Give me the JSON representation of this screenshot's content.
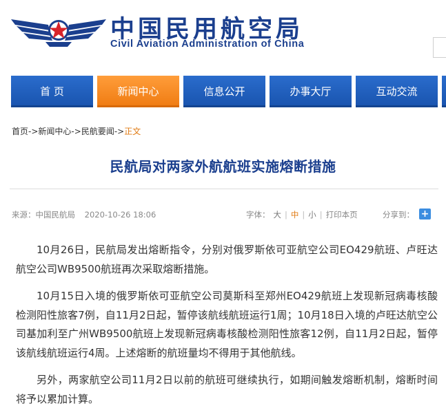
{
  "header": {
    "title_cn": "中国民用航空局",
    "title_en": "Civil Aviation Administration of China"
  },
  "nav": {
    "items": [
      {
        "label": "首  页"
      },
      {
        "label": "新闻中心"
      },
      {
        "label": "信息公开"
      },
      {
        "label": "办事大厅"
      },
      {
        "label": "互动交流"
      }
    ]
  },
  "breadcrumb": {
    "items": [
      "首页",
      "新闻中心",
      "民航要闻"
    ],
    "separator": "->",
    "current": "正文"
  },
  "article": {
    "title": "民航局对两家外航航班实施熔断措施",
    "source": "来源：中国民航局",
    "date": "2020-10-26 18:06",
    "font_label": "字体：",
    "font_options": [
      "大",
      "中",
      "小"
    ],
    "font_active": "中",
    "print_label": "打印本页",
    "share_label": "分享到：",
    "share_icon": "plus-icon",
    "paragraphs": [
      "10月26日，民航局发出熔断指令，分别对俄罗斯依可亚航空公司EO429航班、卢旺达航空公司WB9500航班再次采取熔断措施。",
      "10月15日入境的俄罗斯依可亚航空公司莫斯科至郑州EO429航班上发现新冠病毒核酸检测阳性旅客7例，自11月2日起，暂停该航线航班运行1周；10月18日入境的卢旺达航空公司基加利至广州WB9500航班上发现新冠病毒核酸检测阳性旅客12例，自11月2日起，暂停该航线航班运行4周。上述熔断的航班量均不得用于其他航线。",
      "另外，两家航空公司11月2日以前的航班可继续执行，如期间触发熔断机制，熔断时间将予以累加计算。"
    ]
  },
  "colors": {
    "brand_blue": "#1b3f8e",
    "nav_blue": "#2a6ccc",
    "nav_active": "#f48a24",
    "emblem_red": "#d8232a",
    "accent_orange": "#e07b14"
  }
}
